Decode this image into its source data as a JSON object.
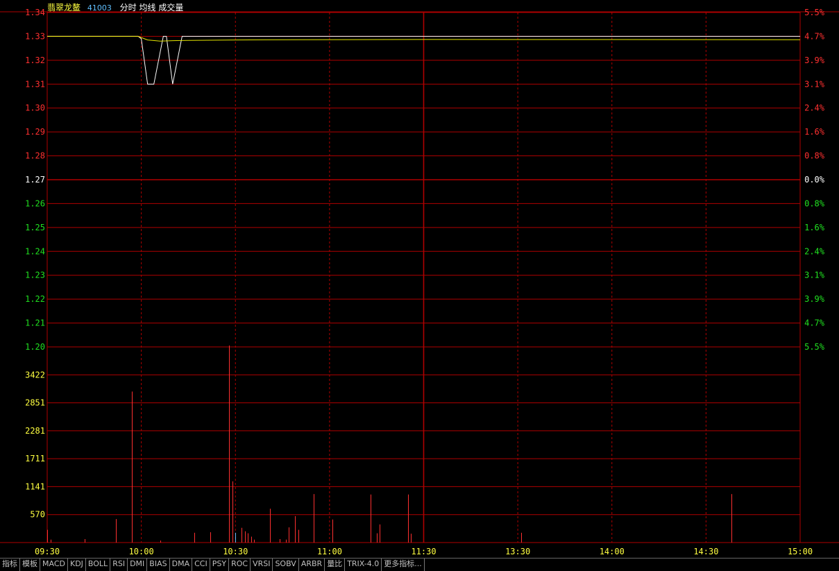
{
  "header": {
    "stock_name": "翡翠龙鳌",
    "code": "41003",
    "legend_items": [
      "分时",
      "均线",
      "成交量"
    ]
  },
  "colors": {
    "grid": "#b00000",
    "up": "#ff3030",
    "down": "#20e020",
    "flat": "#ffffff",
    "price_line": "#ffffff",
    "avg_line": "#e6e600",
    "volume_axis": "#ffff40",
    "time_axis": "#ffff40",
    "name": "#ffff40",
    "code": "#60c0ff"
  },
  "tabs": [
    "指标",
    "模板",
    "MACD",
    "KDJ",
    "BOLL",
    "RSI",
    "DMI",
    "BIAS",
    "DMA",
    "CCI",
    "PSY",
    "ROC",
    "VRSI",
    "SOBV",
    "ARBR",
    "量比",
    "TRIX-4.0",
    "更多指标..."
  ],
  "chart_data": {
    "type": "line",
    "title": "",
    "price_axis": {
      "labels": [
        "1.34",
        "1.33",
        "1.32",
        "1.31",
        "1.30",
        "1.29",
        "1.28",
        "1.27",
        "1.26",
        "1.25",
        "1.24",
        "1.23",
        "1.22",
        "1.21",
        "1.20"
      ],
      "min": 1.2,
      "max": 1.34,
      "base": 1.27
    },
    "pct_axis": {
      "labels": [
        "5.5%",
        "4.7%",
        "3.9%",
        "3.1%",
        "2.4%",
        "1.6%",
        "0.8%",
        "0.0%",
        "0.8%",
        "1.6%",
        "2.4%",
        "3.1%",
        "3.9%",
        "4.7%",
        "5.5%"
      ]
    },
    "time_axis": {
      "labels": [
        "09:30",
        "10:00",
        "10:30",
        "11:00",
        "11:30",
        "13:30",
        "14:00",
        "14:30",
        "15:00"
      ],
      "total_minutes": 240
    },
    "volume_axis": {
      "labels": [
        "3422",
        "2851",
        "2281",
        "1711",
        "1141",
        "570"
      ],
      "max": 3992
    },
    "series": [
      {
        "kind": "price",
        "x": [
          0,
          29,
          30,
          32,
          34,
          37,
          38,
          40,
          43,
          240
        ],
        "y": [
          1.33,
          1.33,
          1.329,
          1.31,
          1.31,
          1.33,
          1.33,
          1.31,
          1.33,
          1.33
        ]
      },
      {
        "kind": "average",
        "x": [
          0,
          29,
          32,
          36,
          40,
          45,
          60,
          80,
          120,
          240
        ],
        "y": [
          1.33,
          1.33,
          1.3285,
          1.328,
          1.3282,
          1.3283,
          1.3285,
          1.3286,
          1.3287,
          1.3286
        ]
      }
    ],
    "volume": [
      {
        "x": 0,
        "v": 260,
        "c": "up"
      },
      {
        "x": 1,
        "v": 60,
        "c": "up"
      },
      {
        "x": 12,
        "v": 70,
        "c": "up"
      },
      {
        "x": 22,
        "v": 480,
        "c": "up"
      },
      {
        "x": 27,
        "v": 3080,
        "c": "up"
      },
      {
        "x": 36,
        "v": 40,
        "c": "up"
      },
      {
        "x": 47,
        "v": 200,
        "c": "up"
      },
      {
        "x": 52,
        "v": 210,
        "c": "up"
      },
      {
        "x": 58,
        "v": 4020,
        "c": "up"
      },
      {
        "x": 59,
        "v": 1250,
        "c": "up"
      },
      {
        "x": 60,
        "v": 200,
        "c": "flat"
      },
      {
        "x": 62,
        "v": 300,
        "c": "up"
      },
      {
        "x": 63,
        "v": 230,
        "c": "up"
      },
      {
        "x": 64,
        "v": 190,
        "c": "up"
      },
      {
        "x": 65,
        "v": 120,
        "c": "up"
      },
      {
        "x": 66,
        "v": 60,
        "c": "up"
      },
      {
        "x": 71,
        "v": 690,
        "c": "up"
      },
      {
        "x": 74,
        "v": 70,
        "c": "up"
      },
      {
        "x": 76,
        "v": 60,
        "c": "up"
      },
      {
        "x": 77,
        "v": 310,
        "c": "up"
      },
      {
        "x": 79,
        "v": 540,
        "c": "up"
      },
      {
        "x": 80,
        "v": 260,
        "c": "up"
      },
      {
        "x": 85,
        "v": 990,
        "c": "up"
      },
      {
        "x": 91,
        "v": 470,
        "c": "up"
      },
      {
        "x": 103,
        "v": 980,
        "c": "up"
      },
      {
        "x": 105,
        "v": 190,
        "c": "up"
      },
      {
        "x": 106,
        "v": 370,
        "c": "up"
      },
      {
        "x": 115,
        "v": 980,
        "c": "up"
      },
      {
        "x": 116,
        "v": 180,
        "c": "up"
      },
      {
        "x": 151,
        "v": 200,
        "c": "up"
      },
      {
        "x": 218,
        "v": 990,
        "c": "up"
      }
    ]
  }
}
